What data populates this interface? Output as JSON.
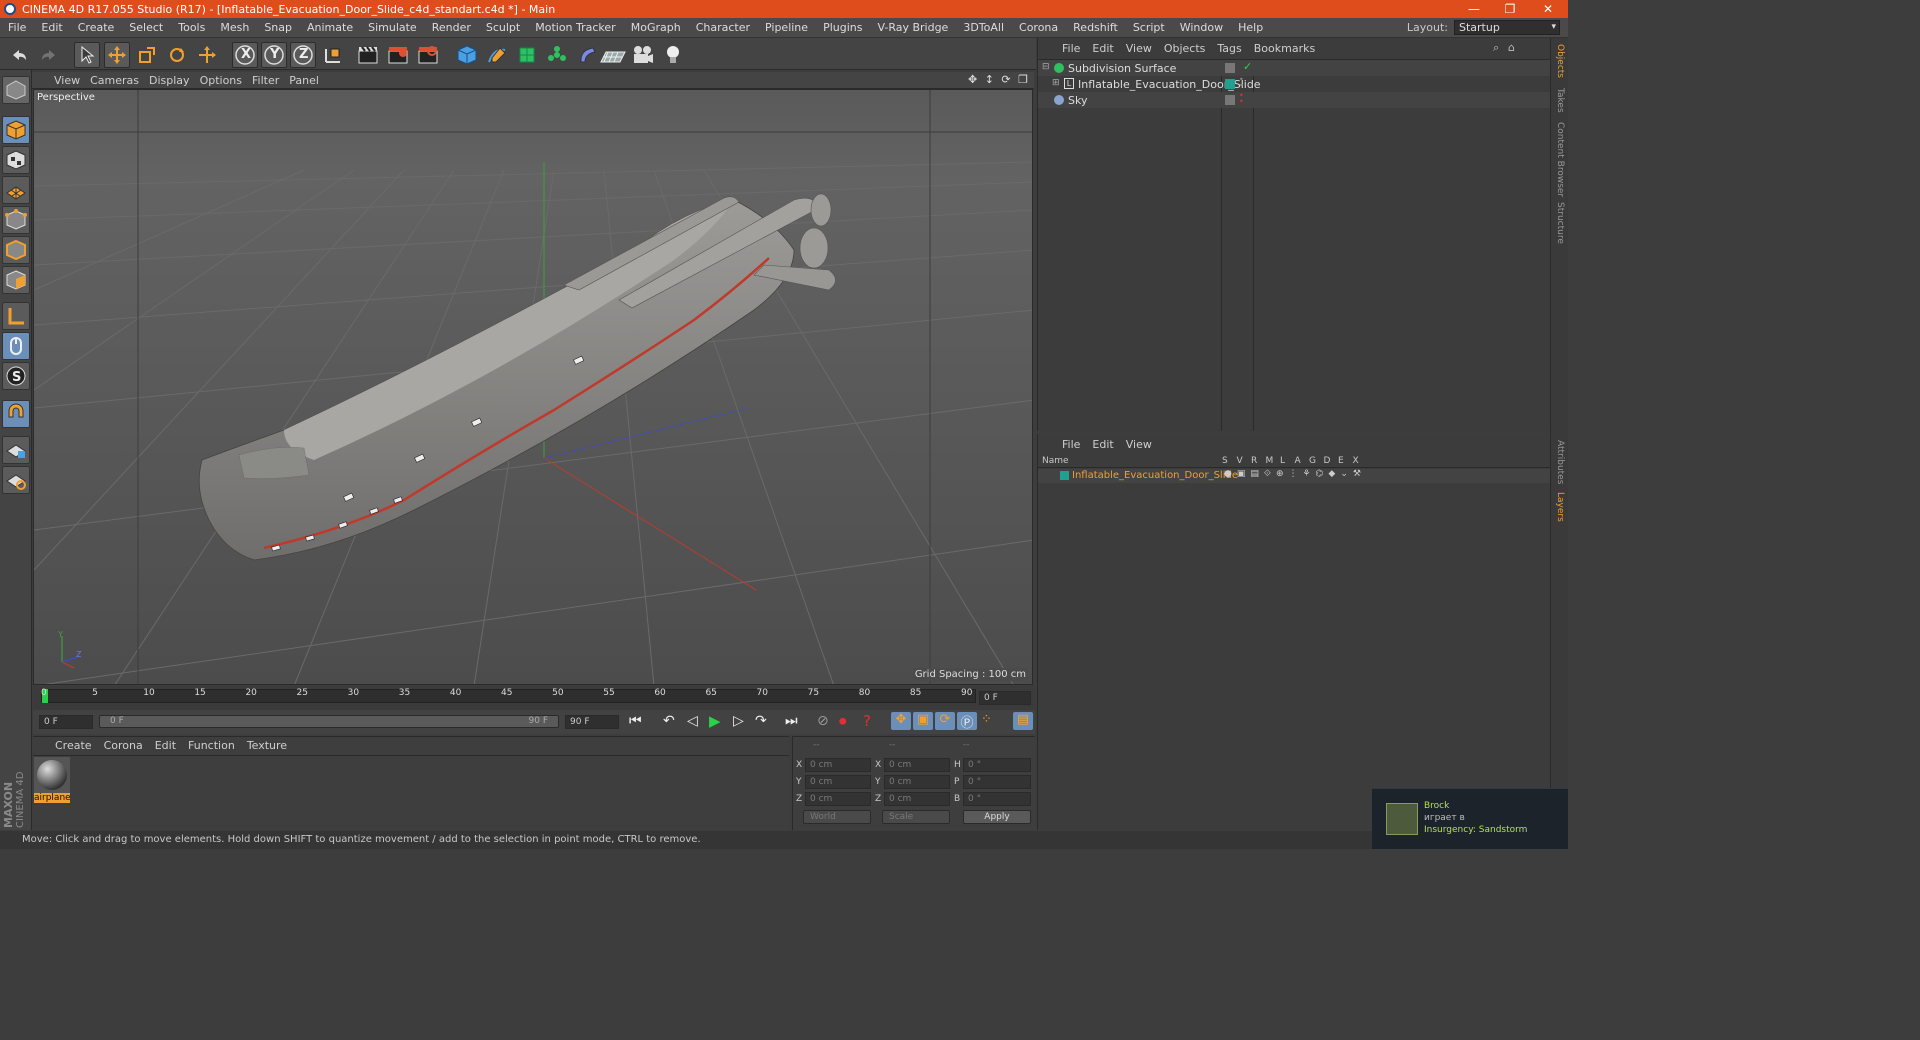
{
  "titlebar": {
    "title": "CINEMA 4D R17.055 Studio (R17) - [Inflatable_Evacuation_Door_Slide_c4d_standart.c4d *] - Main",
    "minimize": "—",
    "restore": "❐",
    "close": "✕"
  },
  "menubar": {
    "items": [
      "File",
      "Edit",
      "Create",
      "Select",
      "Tools",
      "Mesh",
      "Snap",
      "Animate",
      "Simulate",
      "Render",
      "Sculpt",
      "Motion Tracker",
      "MoGraph",
      "Character",
      "Pipeline",
      "Plugins",
      "V-Ray Bridge",
      "3DToAll",
      "Corona",
      "Redshift",
      "Script",
      "Window",
      "Help"
    ],
    "layout_label": "Layout:",
    "layout_value": "Startup"
  },
  "toolbar": {
    "axis_x": "X",
    "axis_y": "Y",
    "axis_z": "Z"
  },
  "viewport": {
    "menu": [
      "View",
      "Cameras",
      "Display",
      "Options",
      "Filter",
      "Panel"
    ],
    "label": "Perspective",
    "grid_spacing": "Grid Spacing : 100 cm",
    "axis_y_label": "Y",
    "axis_z_label": "Z"
  },
  "timeline": {
    "ticks": [
      "0",
      "5",
      "10",
      "15",
      "20",
      "25",
      "30",
      "35",
      "40",
      "45",
      "50",
      "55",
      "60",
      "65",
      "70",
      "75",
      "80",
      "85",
      "90"
    ],
    "current_frame": "0 F"
  },
  "transport": {
    "start_field": "0 F",
    "range_start": "0 F",
    "range_end": "90 F",
    "end_field": "90 F"
  },
  "material_manager": {
    "menu": [
      "Create",
      "Corona",
      "Edit",
      "Function",
      "Texture"
    ],
    "material_name": "airplane",
    "brand_top": "MAXON",
    "brand_bottom": "CINEMA 4D"
  },
  "coords": {
    "header": [
      "--",
      "--",
      "--"
    ],
    "rows": [
      {
        "a": "X",
        "av": "0 cm",
        "b": "X",
        "bv": "0 cm",
        "c": "H",
        "cv": "0 °"
      },
      {
        "a": "Y",
        "av": "0 cm",
        "b": "Y",
        "bv": "0 cm",
        "c": "P",
        "cv": "0 °"
      },
      {
        "a": "Z",
        "av": "0 cm",
        "b": "Z",
        "bv": "0 cm",
        "c": "B",
        "cv": "0 °"
      }
    ],
    "space": "World",
    "mode": "Scale",
    "apply": "Apply"
  },
  "object_manager": {
    "menu": [
      "File",
      "Edit",
      "View",
      "Objects",
      "Tags",
      "Bookmarks"
    ],
    "objects": [
      {
        "name": "Subdivision Surface"
      },
      {
        "name": "Inflatable_Evacuation_Door_Slide"
      },
      {
        "name": "Sky"
      }
    ]
  },
  "layer_manager": {
    "menu": [
      "File",
      "Edit",
      "View"
    ],
    "col_name": "Name",
    "cols": [
      "S",
      "V",
      "R",
      "M",
      "L",
      "A",
      "G",
      "D",
      "E",
      "X"
    ],
    "layer_name": "Inflatable_Evacuation_Door_Slide"
  },
  "right_tabs": [
    "Objects",
    "Takes",
    "Content Browser",
    "Structure",
    "Attributes",
    "Layers"
  ],
  "statusbar": {
    "text": "Move: Click and drag to move elements. Hold down SHIFT to quantize movement / add to the selection in point mode, CTRL to remove."
  },
  "notification": {
    "user": "Brock",
    "action": "играет в",
    "game": "Insurgency: Sandstorm"
  },
  "colors": {
    "titlebar": "#e04d1d",
    "accent_orange": "#f0a030",
    "layer_teal": "#20a090"
  }
}
